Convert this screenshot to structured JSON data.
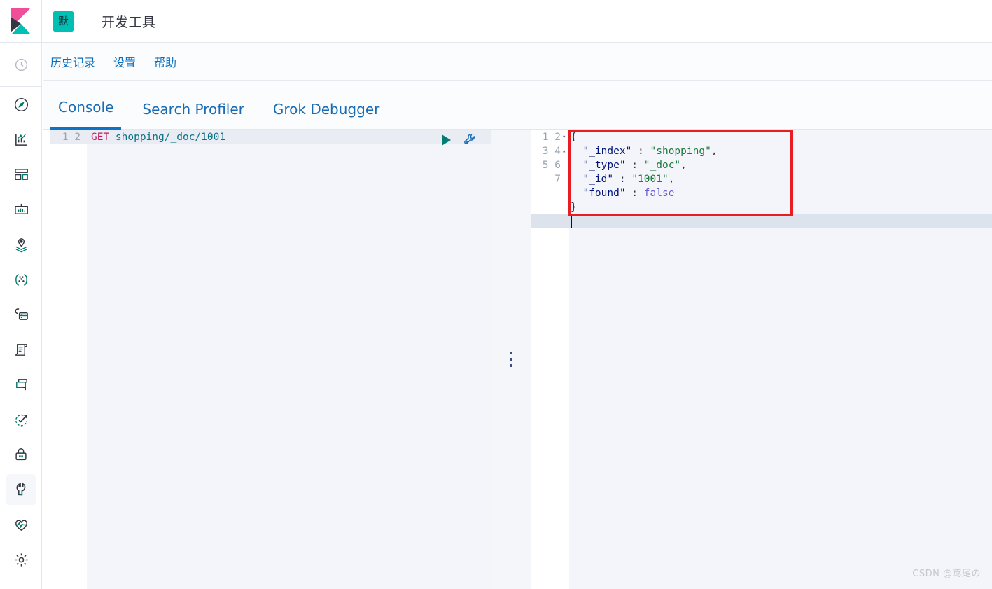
{
  "header": {
    "logo_name": "kibana-logo",
    "space_badge": "默",
    "title": "开发工具"
  },
  "sidebar": {
    "items": [
      {
        "icon": "clock-icon",
        "name": "recently-viewed"
      },
      {
        "icon": "compass-icon",
        "name": "discover"
      },
      {
        "icon": "bar-chart-icon",
        "name": "visualize"
      },
      {
        "icon": "dashboard-icon",
        "name": "dashboard"
      },
      {
        "icon": "canvas-icon",
        "name": "canvas"
      },
      {
        "icon": "maps-icon",
        "name": "maps"
      },
      {
        "icon": "graph-icon",
        "name": "graph"
      },
      {
        "icon": "machine-learning-icon",
        "name": "machine-learning"
      },
      {
        "icon": "logs-icon",
        "name": "logs"
      },
      {
        "icon": "metrics-icon",
        "name": "metrics"
      },
      {
        "icon": "uptime-icon",
        "name": "uptime"
      },
      {
        "icon": "lock-icon",
        "name": "siem"
      },
      {
        "icon": "wrench-icon",
        "name": "dev-tools",
        "active": true
      },
      {
        "icon": "heartbeat-icon",
        "name": "monitoring"
      },
      {
        "icon": "gear-icon",
        "name": "management"
      }
    ]
  },
  "console_nav": {
    "links": [
      {
        "label": "历史记录"
      },
      {
        "label": "设置"
      },
      {
        "label": "帮助"
      }
    ]
  },
  "tabs": [
    {
      "label": "Console",
      "active": true
    },
    {
      "label": "Search Profiler",
      "active": false
    },
    {
      "label": "Grok Debugger",
      "active": false
    }
  ],
  "request_editor": {
    "line_numbers": "1\n2",
    "method": "GET",
    "path": " shopping/_doc/1001",
    "play_label": "send-request",
    "wrench_label": "open-documentation"
  },
  "response_editor": {
    "line_numbers": "1\n2\n3\n4\n5\n6\n7",
    "fold_markers": "▾\n\n\n\n\n▴\n",
    "lines": [
      {
        "text": "{"
      },
      {
        "key": "\"_index\"",
        "sep": " : ",
        "value": "\"shopping\"",
        "kind": "string",
        "tail": ","
      },
      {
        "key": "\"_type\"",
        "sep": " : ",
        "value": "\"_doc\"",
        "kind": "string",
        "tail": ","
      },
      {
        "key": "\"_id\"",
        "sep": " : ",
        "value": "\"1001\"",
        "kind": "string",
        "tail": ","
      },
      {
        "key": "\"found\"",
        "sep": " : ",
        "value": "false",
        "kind": "bool",
        "tail": ""
      },
      {
        "text": "}"
      }
    ],
    "json": {
      "_index": "shopping",
      "_type": "_doc",
      "_id": "1001",
      "found": "false"
    }
  },
  "annotation": {
    "name": "red-highlight-box",
    "color": "#e81c23"
  },
  "watermark": "CSDN @鸢尾の",
  "colors": {
    "accent_blue": "#0e73c7",
    "teal": "#00bfb3",
    "method": "#c2185b",
    "string": "#1a7a3c",
    "key": "#00137a",
    "boolean": "#6b5bd6"
  }
}
